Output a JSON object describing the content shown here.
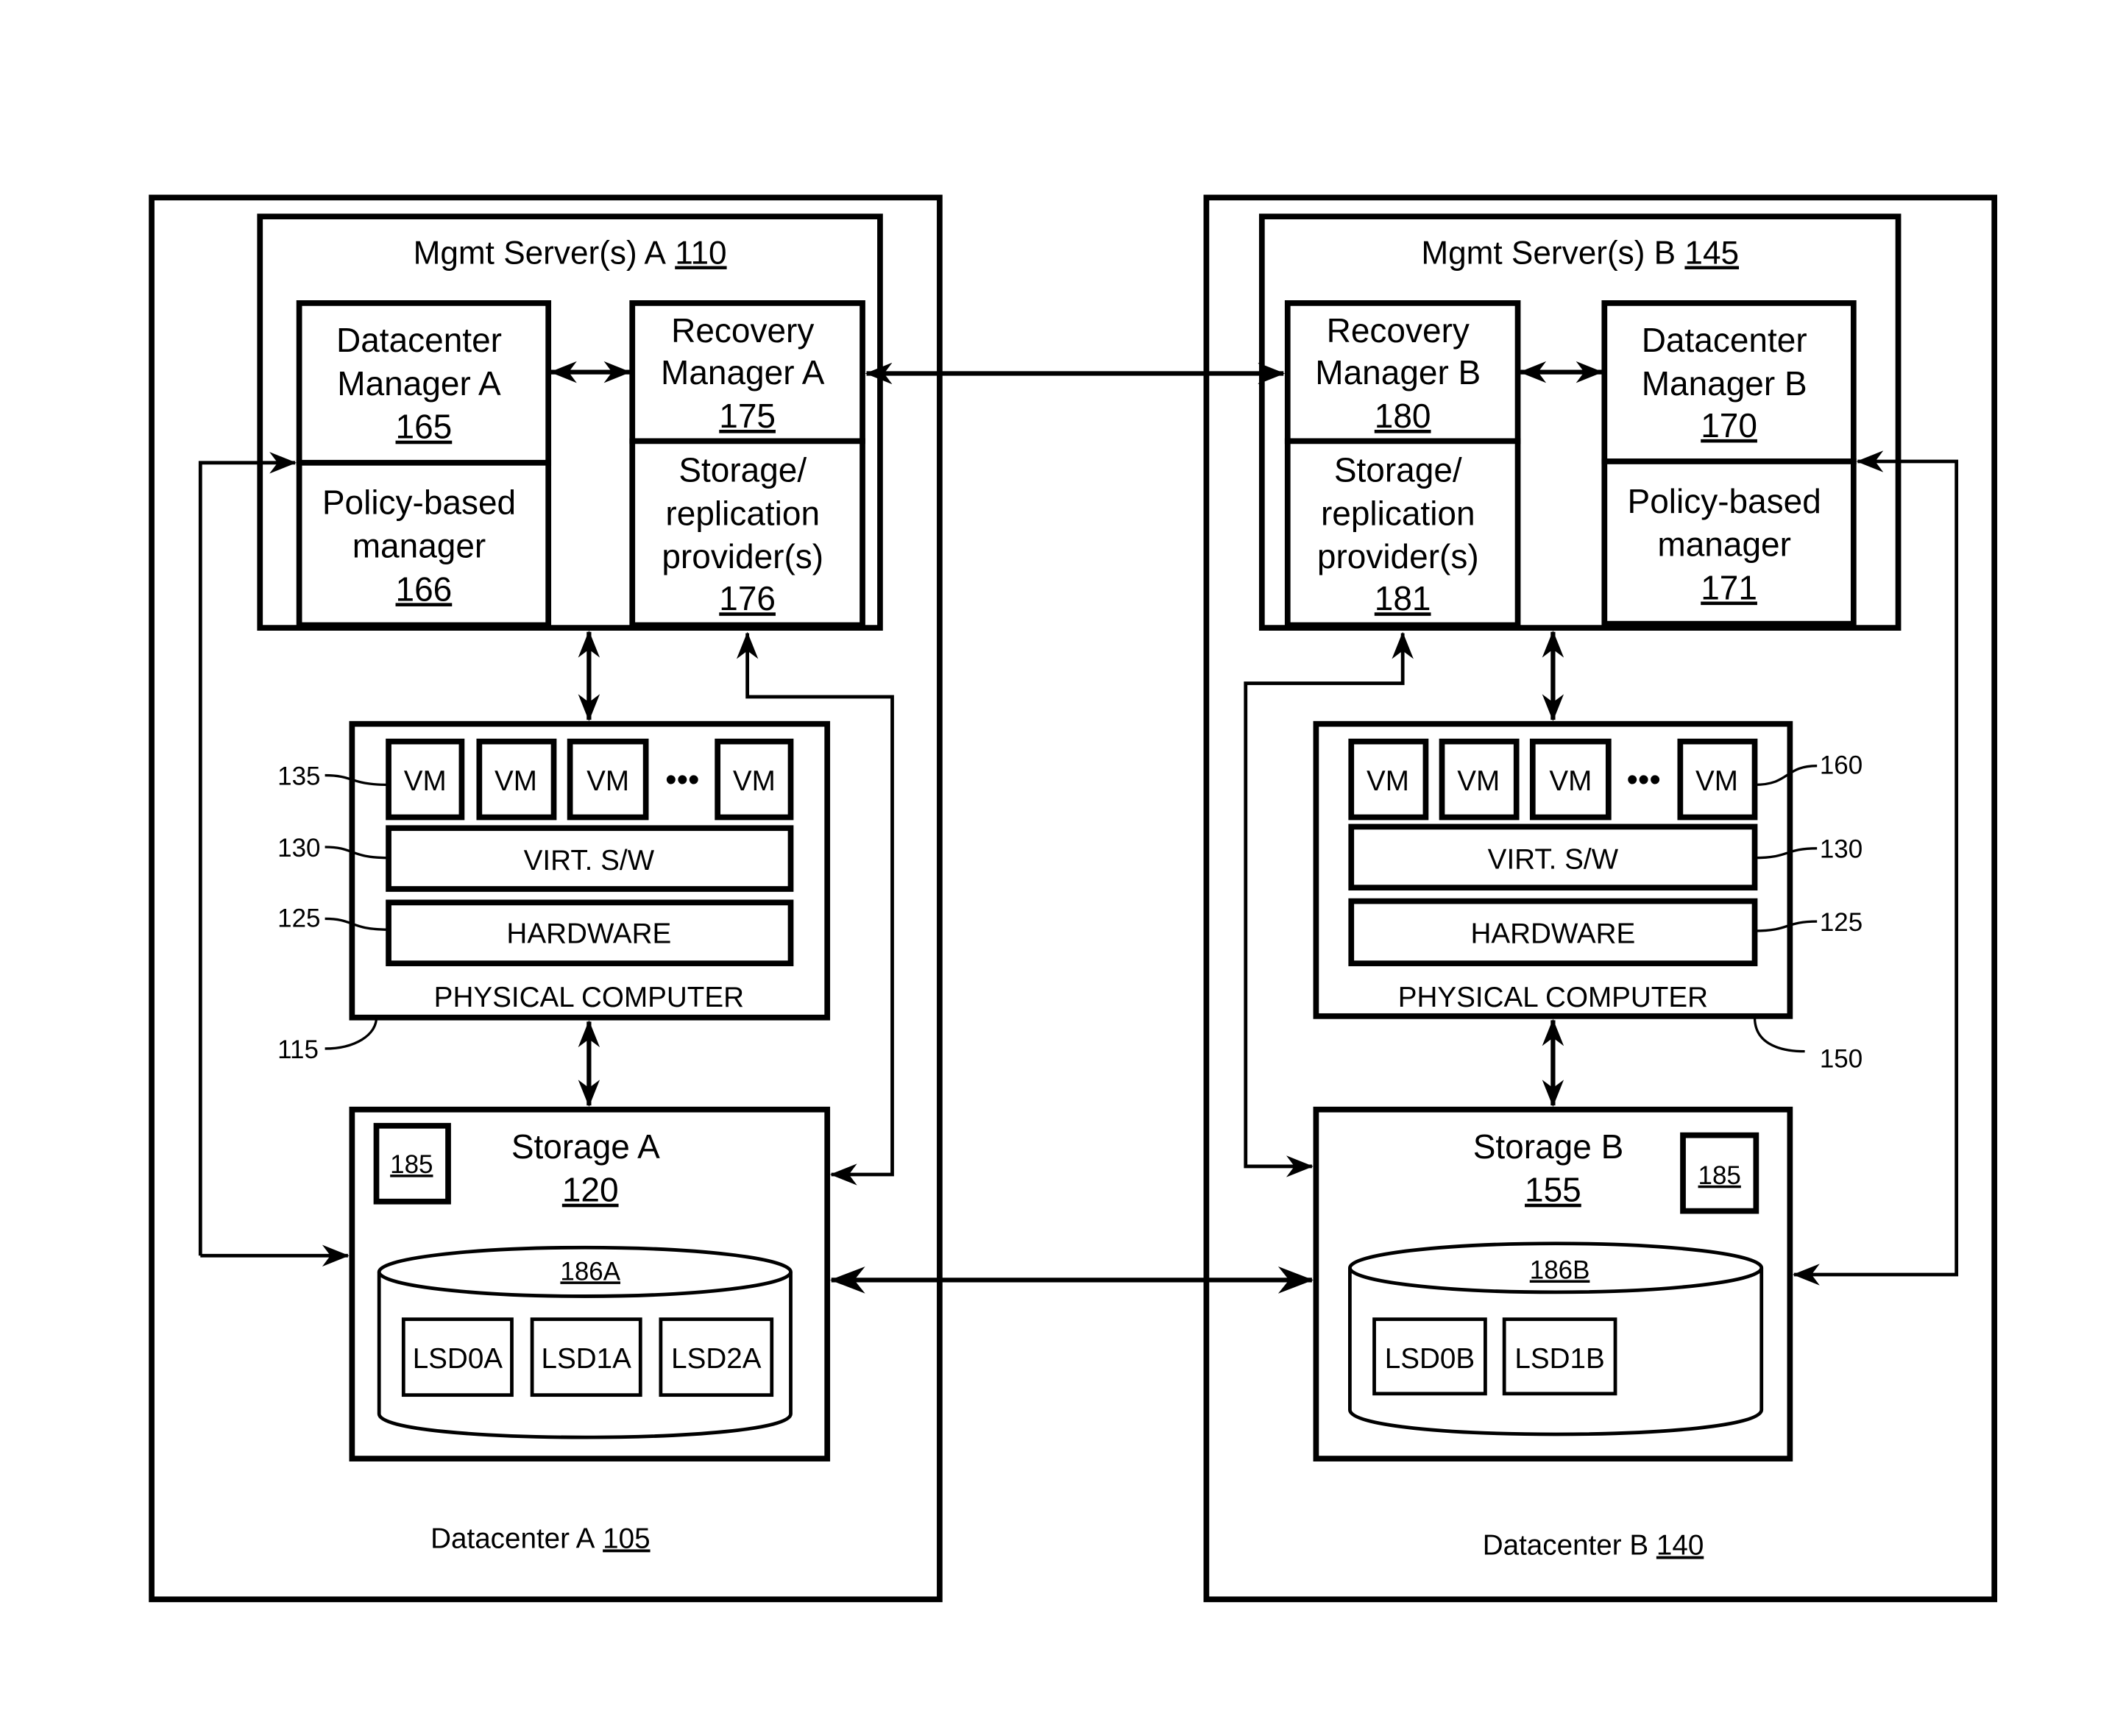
{
  "colors": {
    "stroke": "#000000",
    "background": "#ffffff"
  },
  "datacenter_a": {
    "label": "Datacenter A",
    "ref": "105",
    "mgmt": {
      "title": "Mgmt Server(s) A",
      "ref": "110",
      "datacenter_manager": {
        "line1": "Datacenter",
        "line2": "Manager A",
        "ref": "165"
      },
      "policy_manager": {
        "line1": "Policy-based",
        "line2": "manager",
        "ref": "166"
      },
      "recovery_manager": {
        "line1": "Recovery",
        "line2": "Manager A",
        "ref": "175"
      },
      "storage_provider": {
        "line1": "Storage/",
        "line2": "replication",
        "line3": "provider(s)",
        "ref": "176"
      }
    },
    "physical_computer": {
      "label": "PHYSICAL COMPUTER",
      "ref": "115",
      "vms": [
        "VM",
        "VM",
        "VM",
        "VM"
      ],
      "ellipsis": "•••",
      "vm_ref": "135",
      "virt_sw": "VIRT. S/W",
      "virt_ref": "130",
      "hardware": "HARDWARE",
      "hw_ref": "125"
    },
    "storage": {
      "title": "Storage A",
      "ref": "120",
      "module_ref": "185",
      "array_ref": "186A",
      "lsds": [
        "LSD0A",
        "LSD1A",
        "LSD2A"
      ]
    }
  },
  "datacenter_b": {
    "label": "Datacenter B",
    "ref": "140",
    "mgmt": {
      "title": "Mgmt Server(s) B",
      "ref": "145",
      "recovery_manager": {
        "line1": "Recovery",
        "line2": "Manager B",
        "ref": "180"
      },
      "storage_provider": {
        "line1": "Storage/",
        "line2": "replication",
        "line3": "provider(s)",
        "ref": "181"
      },
      "datacenter_manager": {
        "line1": "Datacenter",
        "line2": "Manager B",
        "ref": "170"
      },
      "policy_manager": {
        "line1": "Policy-based",
        "line2": "manager",
        "ref": "171"
      }
    },
    "physical_computer": {
      "label": "PHYSICAL COMPUTER",
      "ref": "150",
      "vms": [
        "VM",
        "VM",
        "VM",
        "VM"
      ],
      "ellipsis": "•••",
      "vm_ref": "160",
      "virt_sw": "VIRT. S/W",
      "virt_ref": "130",
      "hardware": "HARDWARE",
      "hw_ref": "125"
    },
    "storage": {
      "title": "Storage B",
      "ref": "155",
      "module_ref": "185",
      "array_ref": "186B",
      "lsds": [
        "LSD0B",
        "LSD1B"
      ]
    }
  }
}
